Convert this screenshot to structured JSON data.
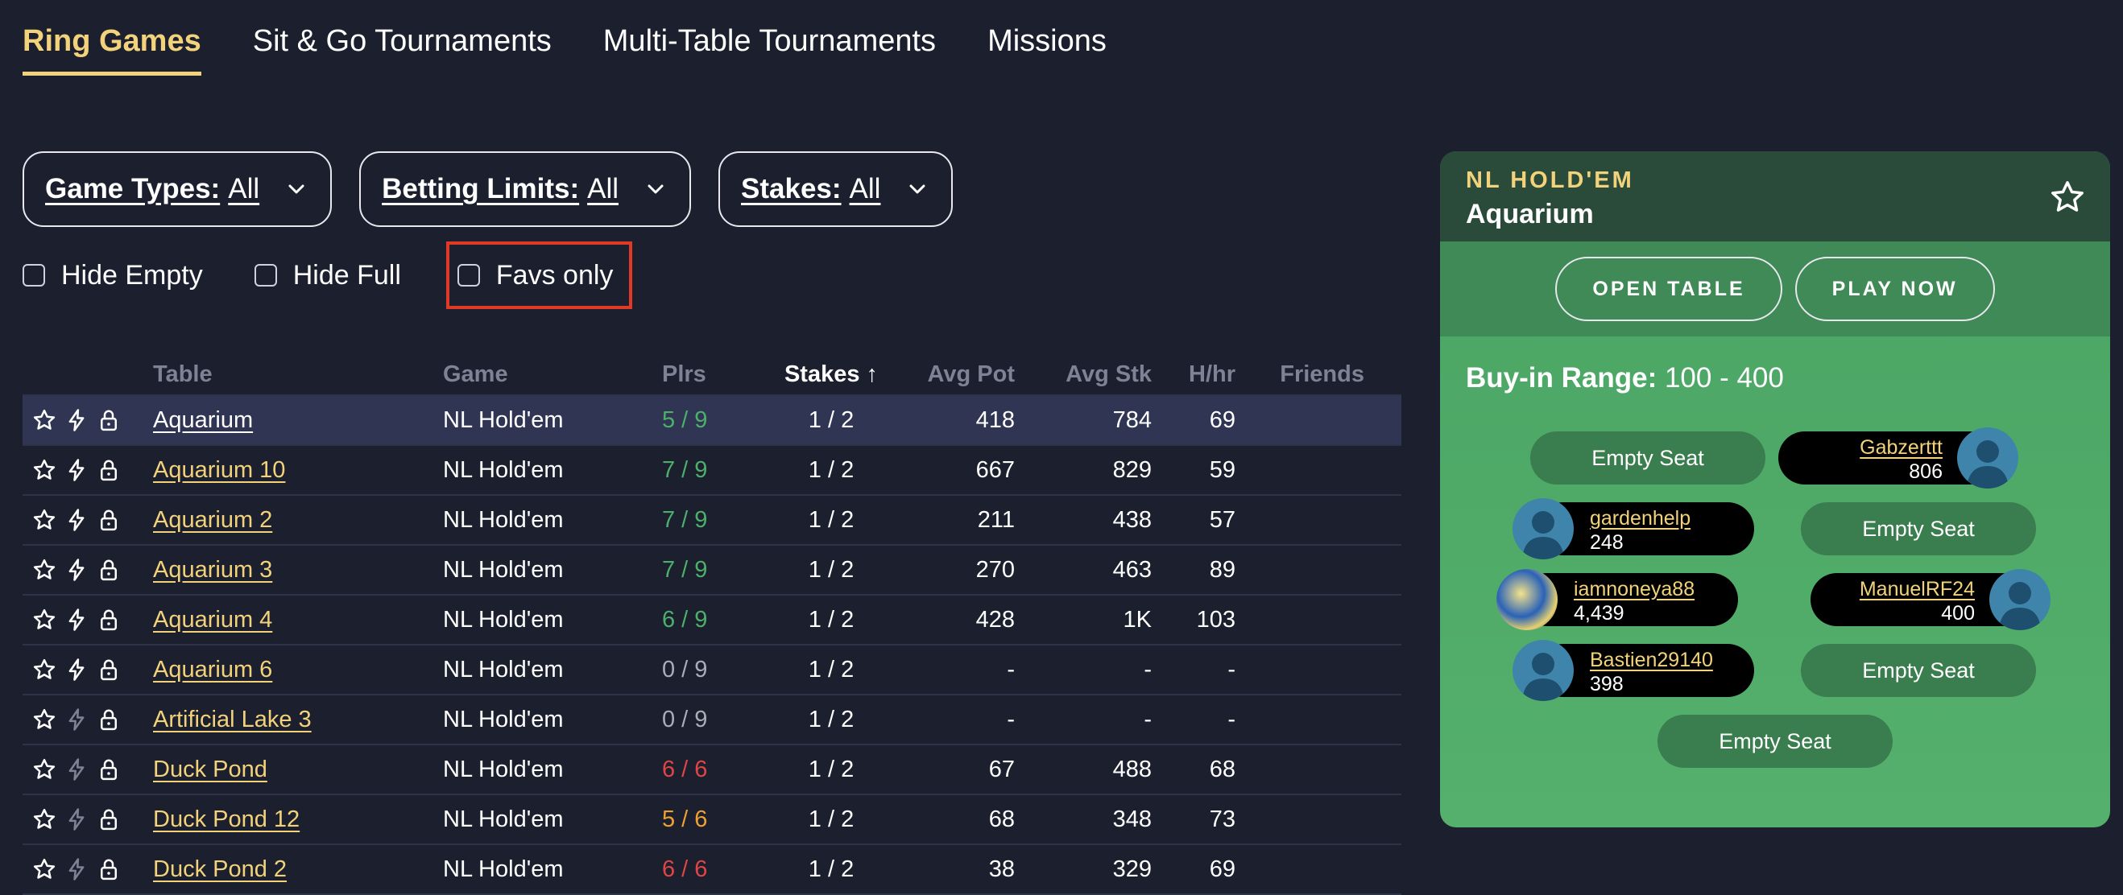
{
  "tabs": [
    {
      "label": "Ring Games",
      "active": true
    },
    {
      "label": "Sit & Go Tournaments"
    },
    {
      "label": "Multi-Table Tournaments"
    },
    {
      "label": "Missions"
    }
  ],
  "filters": [
    {
      "label": "Game Types:",
      "value": "All"
    },
    {
      "label": "Betting Limits:",
      "value": "All"
    },
    {
      "label": "Stakes:",
      "value": "All"
    }
  ],
  "checkboxes": [
    {
      "label": "Hide Empty",
      "checked": false
    },
    {
      "label": "Hide Full",
      "checked": false
    },
    {
      "label": "Favs only",
      "checked": false,
      "highlighted": true
    }
  ],
  "table": {
    "headers": {
      "table": "Table",
      "game": "Game",
      "plrs": "Plrs",
      "stakes": "Stakes ↑",
      "avg_pot": "Avg Pot",
      "avg_stk": "Avg Stk",
      "hhr": "H/hr",
      "friends": "Friends"
    },
    "rows": [
      {
        "name": "Aquarium",
        "game": "NL Hold'em",
        "plrs": "5 / 9",
        "plrs_color": "#4caf6a",
        "stakes": "1 / 2",
        "avg_pot": "418",
        "avg_stk": "784",
        "hhr": "69",
        "selected": true,
        "fast": true
      },
      {
        "name": "Aquarium 10",
        "game": "NL Hold'em",
        "plrs": "7 / 9",
        "plrs_color": "#4caf6a",
        "stakes": "1 / 2",
        "avg_pot": "667",
        "avg_stk": "829",
        "hhr": "59",
        "fast": true
      },
      {
        "name": "Aquarium 2",
        "game": "NL Hold'em",
        "plrs": "7 / 9",
        "plrs_color": "#4caf6a",
        "stakes": "1 / 2",
        "avg_pot": "211",
        "avg_stk": "438",
        "hhr": "57",
        "fast": true
      },
      {
        "name": "Aquarium 3",
        "game": "NL Hold'em",
        "plrs": "7 / 9",
        "plrs_color": "#4caf6a",
        "stakes": "1 / 2",
        "avg_pot": "270",
        "avg_stk": "463",
        "hhr": "89",
        "fast": true
      },
      {
        "name": "Aquarium 4",
        "game": "NL Hold'em",
        "plrs": "6 / 9",
        "plrs_color": "#4caf6a",
        "stakes": "1 / 2",
        "avg_pot": "428",
        "avg_stk": "1K",
        "hhr": "103",
        "fast": true
      },
      {
        "name": "Aquarium 6",
        "game": "NL Hold'em",
        "plrs": "0 / 9",
        "plrs_color": "#a9adb8",
        "stakes": "1 / 2",
        "avg_pot": "-",
        "avg_stk": "-",
        "hhr": "-",
        "fast": true
      },
      {
        "name": "Artificial Lake 3",
        "game": "NL Hold'em",
        "plrs": "0 / 9",
        "plrs_color": "#a9adb8",
        "stakes": "1 / 2",
        "avg_pot": "-",
        "avg_stk": "-",
        "hhr": "-",
        "fast": false
      },
      {
        "name": "Duck Pond",
        "game": "NL Hold'em",
        "plrs": "6 / 6",
        "plrs_color": "#e04545",
        "stakes": "1 / 2",
        "avg_pot": "67",
        "avg_stk": "488",
        "hhr": "68",
        "fast": false
      },
      {
        "name": "Duck Pond 12",
        "game": "NL Hold'em",
        "plrs": "5 / 6",
        "plrs_color": "#f0a030",
        "stakes": "1 / 2",
        "avg_pot": "68",
        "avg_stk": "348",
        "hhr": "73",
        "fast": false
      },
      {
        "name": "Duck Pond 2",
        "game": "NL Hold'em",
        "plrs": "6 / 6",
        "plrs_color": "#e04545",
        "stakes": "1 / 2",
        "avg_pot": "38",
        "avg_stk": "329",
        "hhr": "69",
        "fast": false
      }
    ]
  },
  "panel": {
    "game_type": "NL HOLD'EM",
    "table_name": "Aquarium",
    "open_table": "OPEN TABLE",
    "play_now": "PLAY NOW",
    "buyin_label": "Buy-in Range:",
    "buyin_value": "100 - 400",
    "empty_label": "Empty Seat",
    "players": [
      {
        "name": "Gabzerttt",
        "chips": "806"
      },
      {
        "name": "gardenhelp",
        "chips": "248"
      },
      {
        "name": "iamnoneya88",
        "chips": "4,439"
      },
      {
        "name": "ManuelRF24",
        "chips": "400"
      },
      {
        "name": "Bastien29140",
        "chips": "398"
      }
    ]
  }
}
